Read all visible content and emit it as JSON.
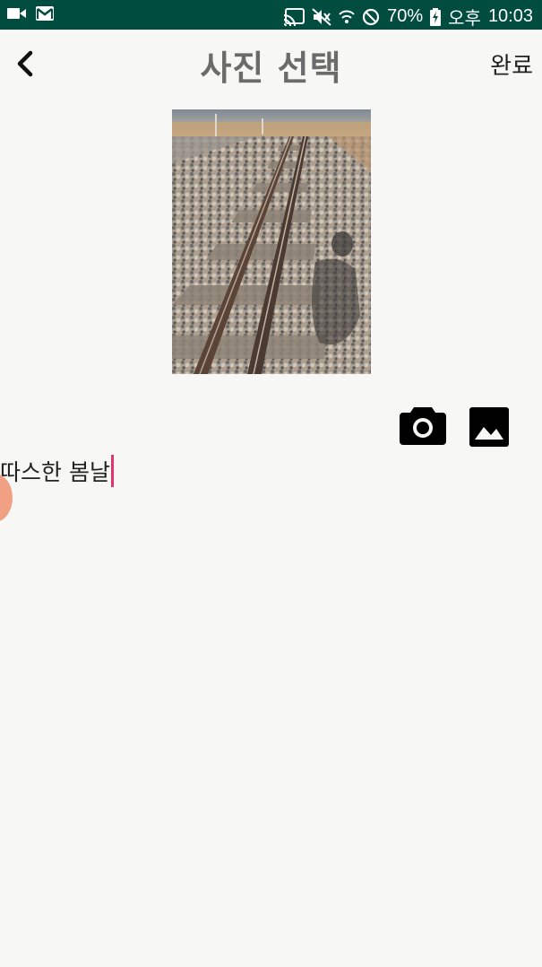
{
  "status_bar": {
    "battery": "70%",
    "ampm": "오후",
    "time": "10:03",
    "icons": [
      "video-camera-icon",
      "gmail-icon",
      "cast-icon",
      "mute-icon",
      "wifi-icon",
      "blocked-icon",
      "battery-charging-icon"
    ]
  },
  "app_bar": {
    "title": "사진 선택",
    "done_label": "완료",
    "back_icon": "chevron-left-icon"
  },
  "photo": {
    "subject": "railroad-track-photo"
  },
  "actions": {
    "camera_icon": "camera-icon",
    "gallery_icon": "image-gallery-icon"
  },
  "input": {
    "value": "따스한 봄날",
    "cursor_color": "#e0356a",
    "handle_color": "#f2a084"
  },
  "colors": {
    "status_bar_bg": "#004d40",
    "background": "#f7f7f5",
    "title": "#6b6b6b"
  }
}
